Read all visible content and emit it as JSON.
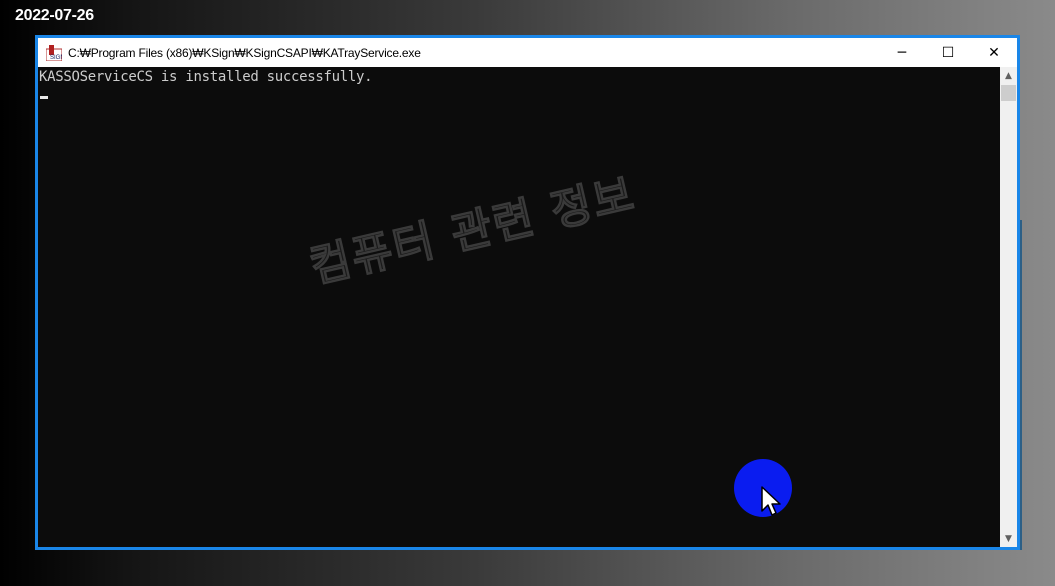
{
  "desktop": {
    "date_label": "2022-07-26"
  },
  "window": {
    "title": "C:₩Program Files (x86)₩KSign₩KSignCSAPI₩KATrayService.exe",
    "icon": "ksign-app-icon",
    "controls": {
      "minimize": "─",
      "maximize": "☐",
      "close": "✕"
    }
  },
  "console": {
    "output_line": "KASSOServiceCS is installed successfully.",
    "cursor": "underscore-cursor"
  },
  "watermark": {
    "text": "컴퓨터 관련 정보"
  },
  "scrollbar": {
    "up_arrow": "▲",
    "down_arrow": "▼"
  },
  "colors": {
    "window_border": "#1a86e8",
    "console_bg": "#0c0c0c",
    "console_text": "#cccccc",
    "click_indicator": "#0a1cf0"
  }
}
